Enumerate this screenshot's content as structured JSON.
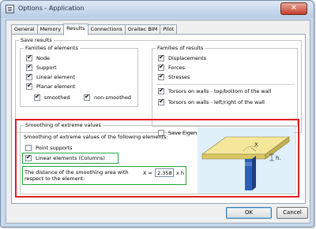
{
  "window": {
    "title": "Options - Application",
    "close_glyph": "✕"
  },
  "tabs": [
    {
      "label": "General",
      "active": false
    },
    {
      "label": "Memory",
      "active": false
    },
    {
      "label": "Results",
      "active": true
    },
    {
      "label": "Connections",
      "active": false
    },
    {
      "label": "Graitec BIM",
      "active": false
    },
    {
      "label": "Pilot",
      "active": false
    }
  ],
  "save_results": {
    "title": "Save results",
    "families_elements": {
      "title": "Families of elements",
      "items": [
        {
          "label": "Node",
          "checked": true
        },
        {
          "label": "Support",
          "checked": true
        },
        {
          "label": "Linear element",
          "checked": true
        },
        {
          "label": "Planar element",
          "checked": true
        }
      ],
      "sub_items": [
        {
          "label": "smoothed",
          "checked": true
        },
        {
          "label": "non-smoothed",
          "checked": true
        }
      ]
    },
    "families_results": {
      "title": "Families of results",
      "items": [
        {
          "label": "Displacements",
          "checked": true
        },
        {
          "label": "Forces",
          "checked": true
        },
        {
          "label": "Stresses",
          "checked": true
        }
      ],
      "torsors": [
        {
          "label": "Torsors on walls - top/bottom of the wall",
          "checked": true
        },
        {
          "label": "Torsors on walls - left/right of the wall",
          "checked": true
        }
      ],
      "eigen": {
        "label": "Save Eigen modes results",
        "checked": false
      }
    }
  },
  "smoothing": {
    "title": "Smoothing of extreme values",
    "intro": "Smoothing of extreme values of the following elements:",
    "point_supports": {
      "label": "Point supports",
      "checked": false
    },
    "linear_elements": {
      "label": "Linear elements (Columns)",
      "checked": true
    },
    "distance_label": "The distance of the smoothing area with respect to the element:",
    "x_prefix": "X =",
    "x_value": "2.358",
    "x_suffix": "x h",
    "figure_labels": {
      "x": "X",
      "h": "h."
    }
  },
  "buttons": {
    "ok": "OK",
    "cancel": "Cancel"
  },
  "colors": {
    "highlight_red": "#e02020",
    "highlight_green": "#22a83a",
    "slab": "#f4e79a",
    "column": "#2e5fb8"
  },
  "icons": {
    "title": "window-icon",
    "close": "close-icon",
    "check": "checkmark-icon"
  }
}
